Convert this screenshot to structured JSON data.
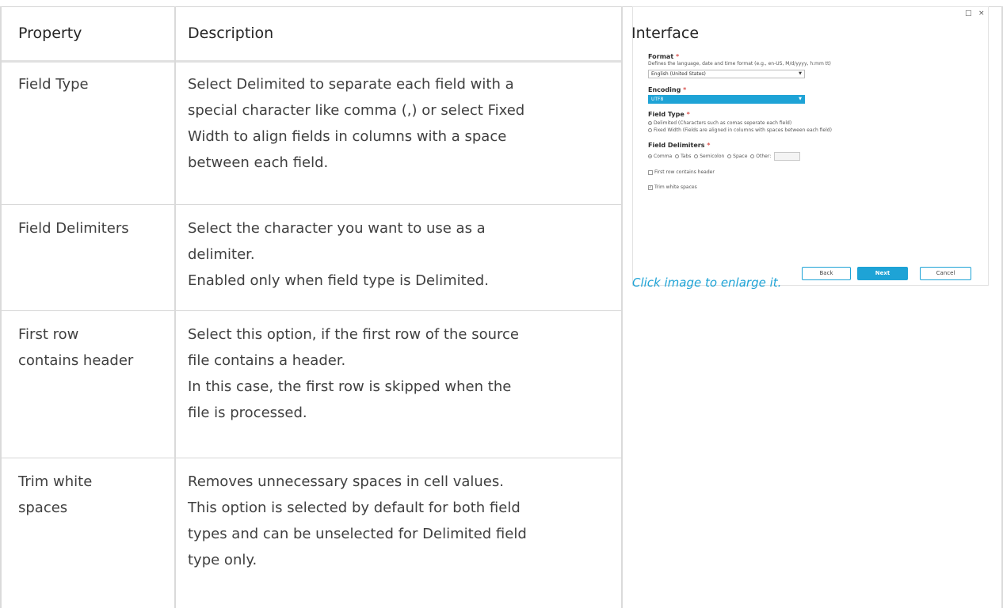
{
  "table": {
    "headers": {
      "property": "Property",
      "description": "Description",
      "interface": "Interface"
    },
    "rows": [
      {
        "property": [
          "Field Type"
        ],
        "description": [
          "Select Delimited to separate each field with a",
          "special character like comma (,) or select Fixed",
          "Width to align fields in columns with a space",
          "between each field."
        ]
      },
      {
        "property": [
          "Field Delimiters"
        ],
        "description": [
          "Select the character you want to use as a",
          "delimiter.",
          "Enabled only when field type is Delimited."
        ]
      },
      {
        "property": [
          "First row",
          "contains header"
        ],
        "description": [
          "Select this option, if the first row of the source",
          "file contains a header.",
          "In this case, the first row is skipped when the",
          "file is processed."
        ]
      },
      {
        "property": [
          "Trim white",
          "spaces"
        ],
        "description": [
          "Removes unnecessary spaces in cell values.",
          "This option is selected by default for both field",
          "types and can be unselected for Delimited field",
          "type only."
        ]
      }
    ]
  },
  "dialog": {
    "maximize_icon": "square-icon",
    "close_icon": "close-icon",
    "format": {
      "label": "Format",
      "required_mark": "*",
      "help": "Defines the language, date and time format (e.g., en-US, M/d/yyyy, h:mm tt)",
      "value": "English (United States)"
    },
    "encoding": {
      "label": "Encoding",
      "required_mark": "*",
      "value": "UTF8"
    },
    "field_type": {
      "label": "Field Type",
      "required_mark": "*",
      "options": [
        {
          "label": "Delimited (Characters such as comas seperate each field)",
          "selected": true
        },
        {
          "label": "Fixed Width (Fields are aligned in columns with spaces between each field)",
          "selected": false
        }
      ]
    },
    "field_delimiters": {
      "label": "Field Delimiters",
      "required_mark": "*",
      "options": [
        {
          "label": "Comma",
          "selected": true
        },
        {
          "label": "Tabs",
          "selected": false
        },
        {
          "label": "Semicolon",
          "selected": false
        },
        {
          "label": "Space",
          "selected": false
        },
        {
          "label": "Other:",
          "selected": false
        }
      ]
    },
    "first_row_header": {
      "label": "First row contains header",
      "checked": false
    },
    "trim_white_spaces": {
      "label": "Trim white spaces",
      "checked": true
    },
    "buttons": {
      "back": "Back",
      "next": "Next",
      "cancel": "Cancel"
    },
    "accent_color": "#1ea3d6"
  },
  "caption": "Click image to enlarge it."
}
